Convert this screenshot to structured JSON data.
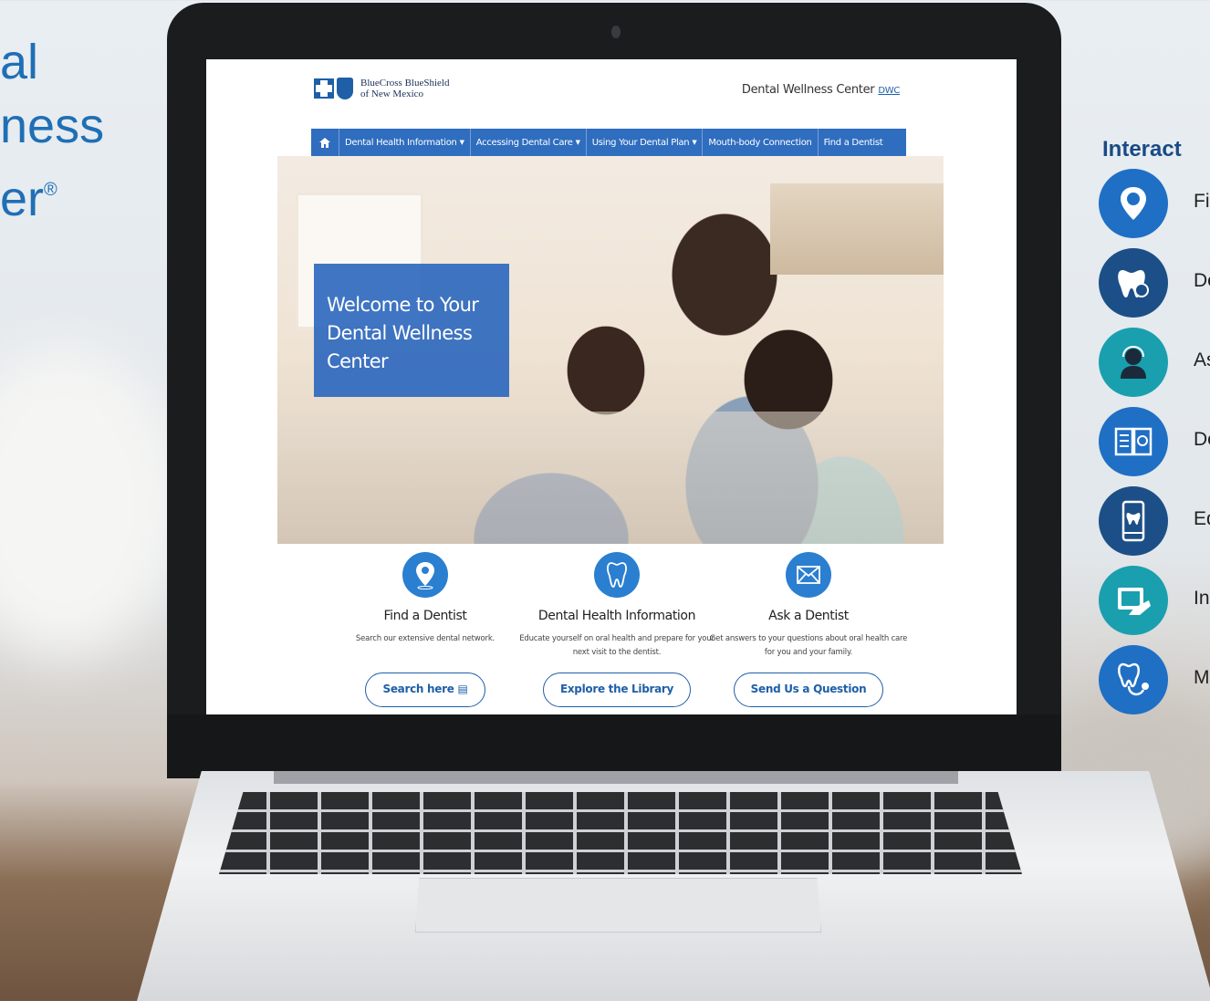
{
  "side_title": {
    "line1": "al",
    "line2": "ness",
    "line3": "er",
    "reg_mark": "®"
  },
  "right_panel": {
    "heading": "Interact",
    "items": [
      {
        "label": "Fi",
        "icon": "location-pin-icon",
        "color": "#1f6fc5"
      },
      {
        "label": "De",
        "icon": "tooth-search-icon",
        "color": "#1c4f87"
      },
      {
        "label": "As",
        "icon": "headset-person-icon",
        "color": "#1a9fae"
      },
      {
        "label": "De",
        "icon": "book-icon",
        "color": "#1f6fc5"
      },
      {
        "label": "Ed",
        "icon": "phone-tooth-icon",
        "color": "#1c4f87"
      },
      {
        "label": "In",
        "icon": "tablet-hand-icon",
        "color": "#1a9fae"
      },
      {
        "label": "M",
        "icon": "stethoscope-tooth-icon",
        "color": "#1f6fc5"
      }
    ]
  },
  "site": {
    "logo_line1": "BlueCross BlueShield",
    "logo_line2": "of New Mexico",
    "dwc_title": "Dental Wellness Center",
    "dwc_badge": "DWC",
    "nav": [
      {
        "label": "Dental Health Information",
        "dropdown": true
      },
      {
        "label": "Accessing Dental Care",
        "dropdown": true
      },
      {
        "label": "Using Your Dental Plan",
        "dropdown": true
      },
      {
        "label": "Mouth-body Connection",
        "dropdown": false
      },
      {
        "label": "Find a Dentist",
        "dropdown": false
      }
    ],
    "hero_text": "Welcome to Your Dental Wellness Center",
    "features": [
      {
        "title": "Find a Dentist",
        "desc": "Search our extensive dental network.",
        "button": "Search here",
        "icon": "location-pin-icon"
      },
      {
        "title": "Dental Health Information",
        "desc": "Educate yourself on oral health and prepare for your next visit to the dentist.",
        "button": "Explore the Library",
        "icon": "tooth-icon"
      },
      {
        "title": "Ask a Dentist",
        "desc": "Get answers to your questions about oral health care for you and your family.",
        "button": "Send Us a Question",
        "icon": "envelope-icon"
      }
    ]
  },
  "colors": {
    "brand_blue": "#2f6dbf",
    "link_blue": "#1e5fa8",
    "title_blue": "#1f6fb5"
  }
}
